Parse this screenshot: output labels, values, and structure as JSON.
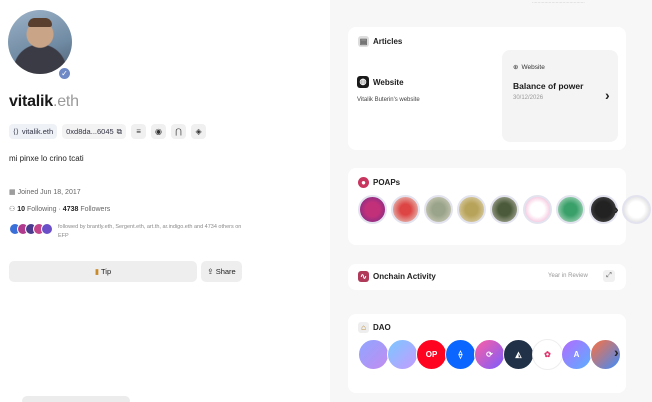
{
  "header_fade": "......................................",
  "profile": {
    "name": "vitalik",
    "tld": ".eth",
    "ens_chip": "vitalik.eth",
    "address_chip": "0xd8da...6045",
    "bio": "mi pinxe lo crino tcati",
    "joined": "Joined Jun 18, 2017",
    "following_count": "10",
    "following_label": "Following",
    "followers_count": "4738",
    "followers_label": "Followers",
    "mutuals_text": "followed by brantly.eth, Sergent.eth, art.th, ar.indigo.eth and 4734 others on EFP",
    "tip_label": "Tip",
    "share_label": "Share"
  },
  "articles": {
    "title": "Articles",
    "website_label": "Website",
    "website_sub": "Vitalik Buterin's website",
    "post_label": "Website",
    "post_title": "Balance of power",
    "post_date": "30/12/2026"
  },
  "poaps": {
    "title": "POAPs"
  },
  "onchain": {
    "title": "Onchain Activity",
    "year_review": "Year in Review"
  },
  "dao": {
    "title": "DAO",
    "op_label": "OP"
  },
  "colors": {
    "accent": "#6f89c7",
    "op_red": "#ff0420"
  }
}
